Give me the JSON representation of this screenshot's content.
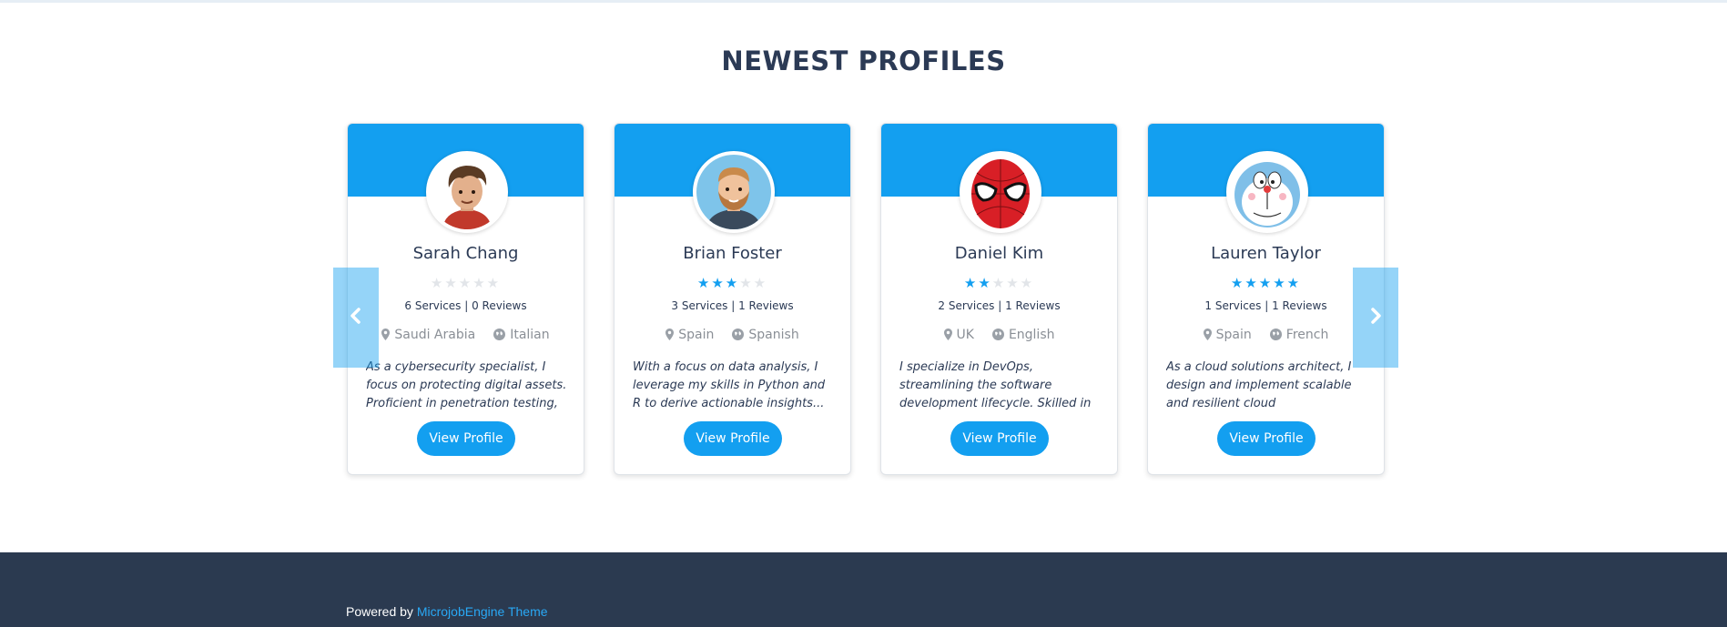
{
  "section": {
    "title": "NEWEST PROFILES"
  },
  "colors": {
    "accent": "#139ff0",
    "footer_bg": "#2b3a50",
    "text": "#2b3a55"
  },
  "profiles": [
    {
      "name": "Sarah Chang",
      "rating": 0,
      "stats": "6 Services | 0 Reviews",
      "country": "Saudi Arabia",
      "language": "Italian",
      "bio": "As a cybersecurity specialist, I focus on protecting digital assets. Proficient in penetration testing,",
      "button": "View Profile",
      "avatar_icon": "boy-avatar-icon"
    },
    {
      "name": "Brian Foster",
      "rating": 3,
      "stats": "3 Services | 1 Reviews",
      "country": "Spain",
      "language": "Spanish",
      "bio": "With a focus on data analysis, I leverage my skills in Python and R to derive actionable insights...",
      "button": "View Profile",
      "avatar_icon": "bearded-man-avatar-icon"
    },
    {
      "name": "Daniel Kim",
      "rating": 2,
      "stats": "2 Services | 1 Reviews",
      "country": "UK",
      "language": "English",
      "bio": "I specialize in DevOps, streamlining the software development lifecycle. Skilled in CI/CD pipelines, Docker,",
      "button": "View Profile",
      "avatar_icon": "spider-mask-avatar-icon"
    },
    {
      "name": "Lauren Taylor",
      "rating": 5,
      "stats": "1 Services | 1 Reviews",
      "country": "Spain",
      "language": "French",
      "bio": "As a cloud solutions architect, I design and implement scalable and resilient cloud infrastructures.",
      "button": "View Profile",
      "avatar_icon": "robot-cat-avatar-icon"
    }
  ],
  "carousel": {
    "prev_icon": "chevron-left-icon",
    "next_icon": "chevron-right-icon"
  },
  "footer": {
    "powered_by": "Powered by",
    "theme_link": "MicrojobEngine Theme"
  }
}
